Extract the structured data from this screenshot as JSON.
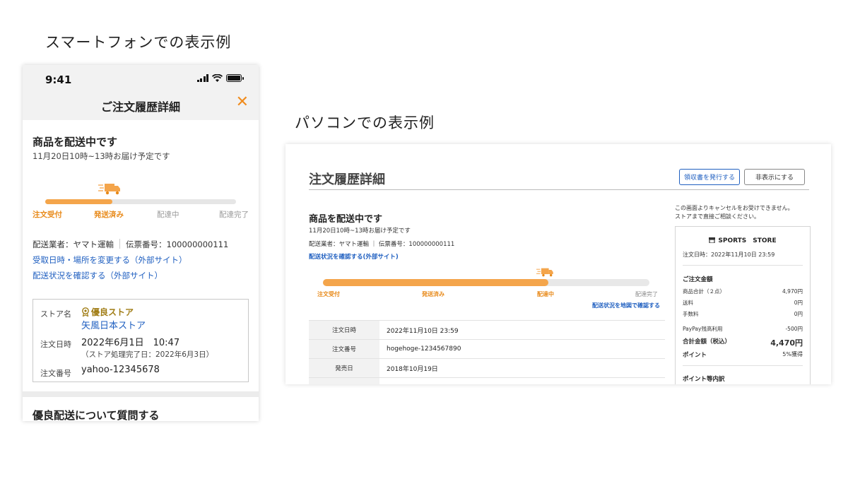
{
  "captions": {
    "smartphone": "スマートフォンでの表示例",
    "pc": "パソコンでの表示例"
  },
  "phone": {
    "status_time": "9:41",
    "header_title": "ご注文履歴詳細",
    "close_icon": "close-icon",
    "status_title": "商品を配送中です",
    "status_sub": "11月20日10時~13時お届け予定です",
    "progress": {
      "steps": [
        "注文受付",
        "発送済み",
        "配達中",
        "配達完了"
      ],
      "completed_steps": 2,
      "fill_fraction": 0.35
    },
    "carrier": "配送業者：ヤマト運輸",
    "tracking": "伝票番号：100000000111",
    "link_change": "受取日時・場所を変更する（外部サイト）",
    "link_status": "配送状況を確認する（外部サイト）",
    "info": {
      "store_label": "ストア名",
      "store_badge": "優良ストア",
      "store_name": "矢風日本ストア",
      "date_label": "注文日時",
      "date_value": "2022年6月1日　10:47",
      "date_note": "（ストア処理完了日：2022年6月3日）",
      "order_label": "注文番号",
      "order_value": "yahoo-12345678"
    },
    "question_title": "優良配送について質問する"
  },
  "pc": {
    "title": "注文履歴詳細",
    "btn_receipt": "領収書を発行する",
    "btn_hide": "非表示にする",
    "status_title": "商品を配送中です",
    "status_sub": "11月20日10時~13時お届け予定です",
    "carrier_line": "配送業者：ヤマト運輸 ｜ 伝票番号：100000000111",
    "link_status": "配送状況を確認する(外部サイト)",
    "progress": {
      "steps": [
        "注文受付",
        "発送済み",
        "配達中",
        "配達完了"
      ],
      "completed_steps": 3,
      "fill_fraction": 0.69
    },
    "link_map": "配送状況を地図で確認する",
    "table": [
      {
        "label": "注文日時",
        "value": "2022年11月10日 23:59"
      },
      {
        "label": "注文番号",
        "value": "hogehoge-1234567890"
      },
      {
        "label": "発売日",
        "value": "2018年10月19日"
      }
    ],
    "note_line1": "この画面よりキャンセルをお受けできません。",
    "note_line2": "ストアまで直接ご相談ください。",
    "side": {
      "store": "SPORTS　STORE",
      "date": "注文日時：2022年11月10日 23:59",
      "amount_title": "ご注文金額",
      "rows": [
        {
          "label": "商品合計（２点）",
          "value": "4,970円"
        },
        {
          "label": "送料",
          "value": "0円"
        },
        {
          "label": "手数料",
          "value": "0円"
        }
      ],
      "paypay_label": "PayPay残高利用",
      "paypay_value": "-500円",
      "total_label": "合計金額（税込）",
      "total_value": "4,470円",
      "point_label": "ポイント",
      "point_value": "5%獲得",
      "points_title": "ポイント等内訳"
    }
  },
  "colors": {
    "accent_orange": "#f4a54b",
    "link_blue": "#1f5fc0",
    "gold": "#a07c14"
  }
}
